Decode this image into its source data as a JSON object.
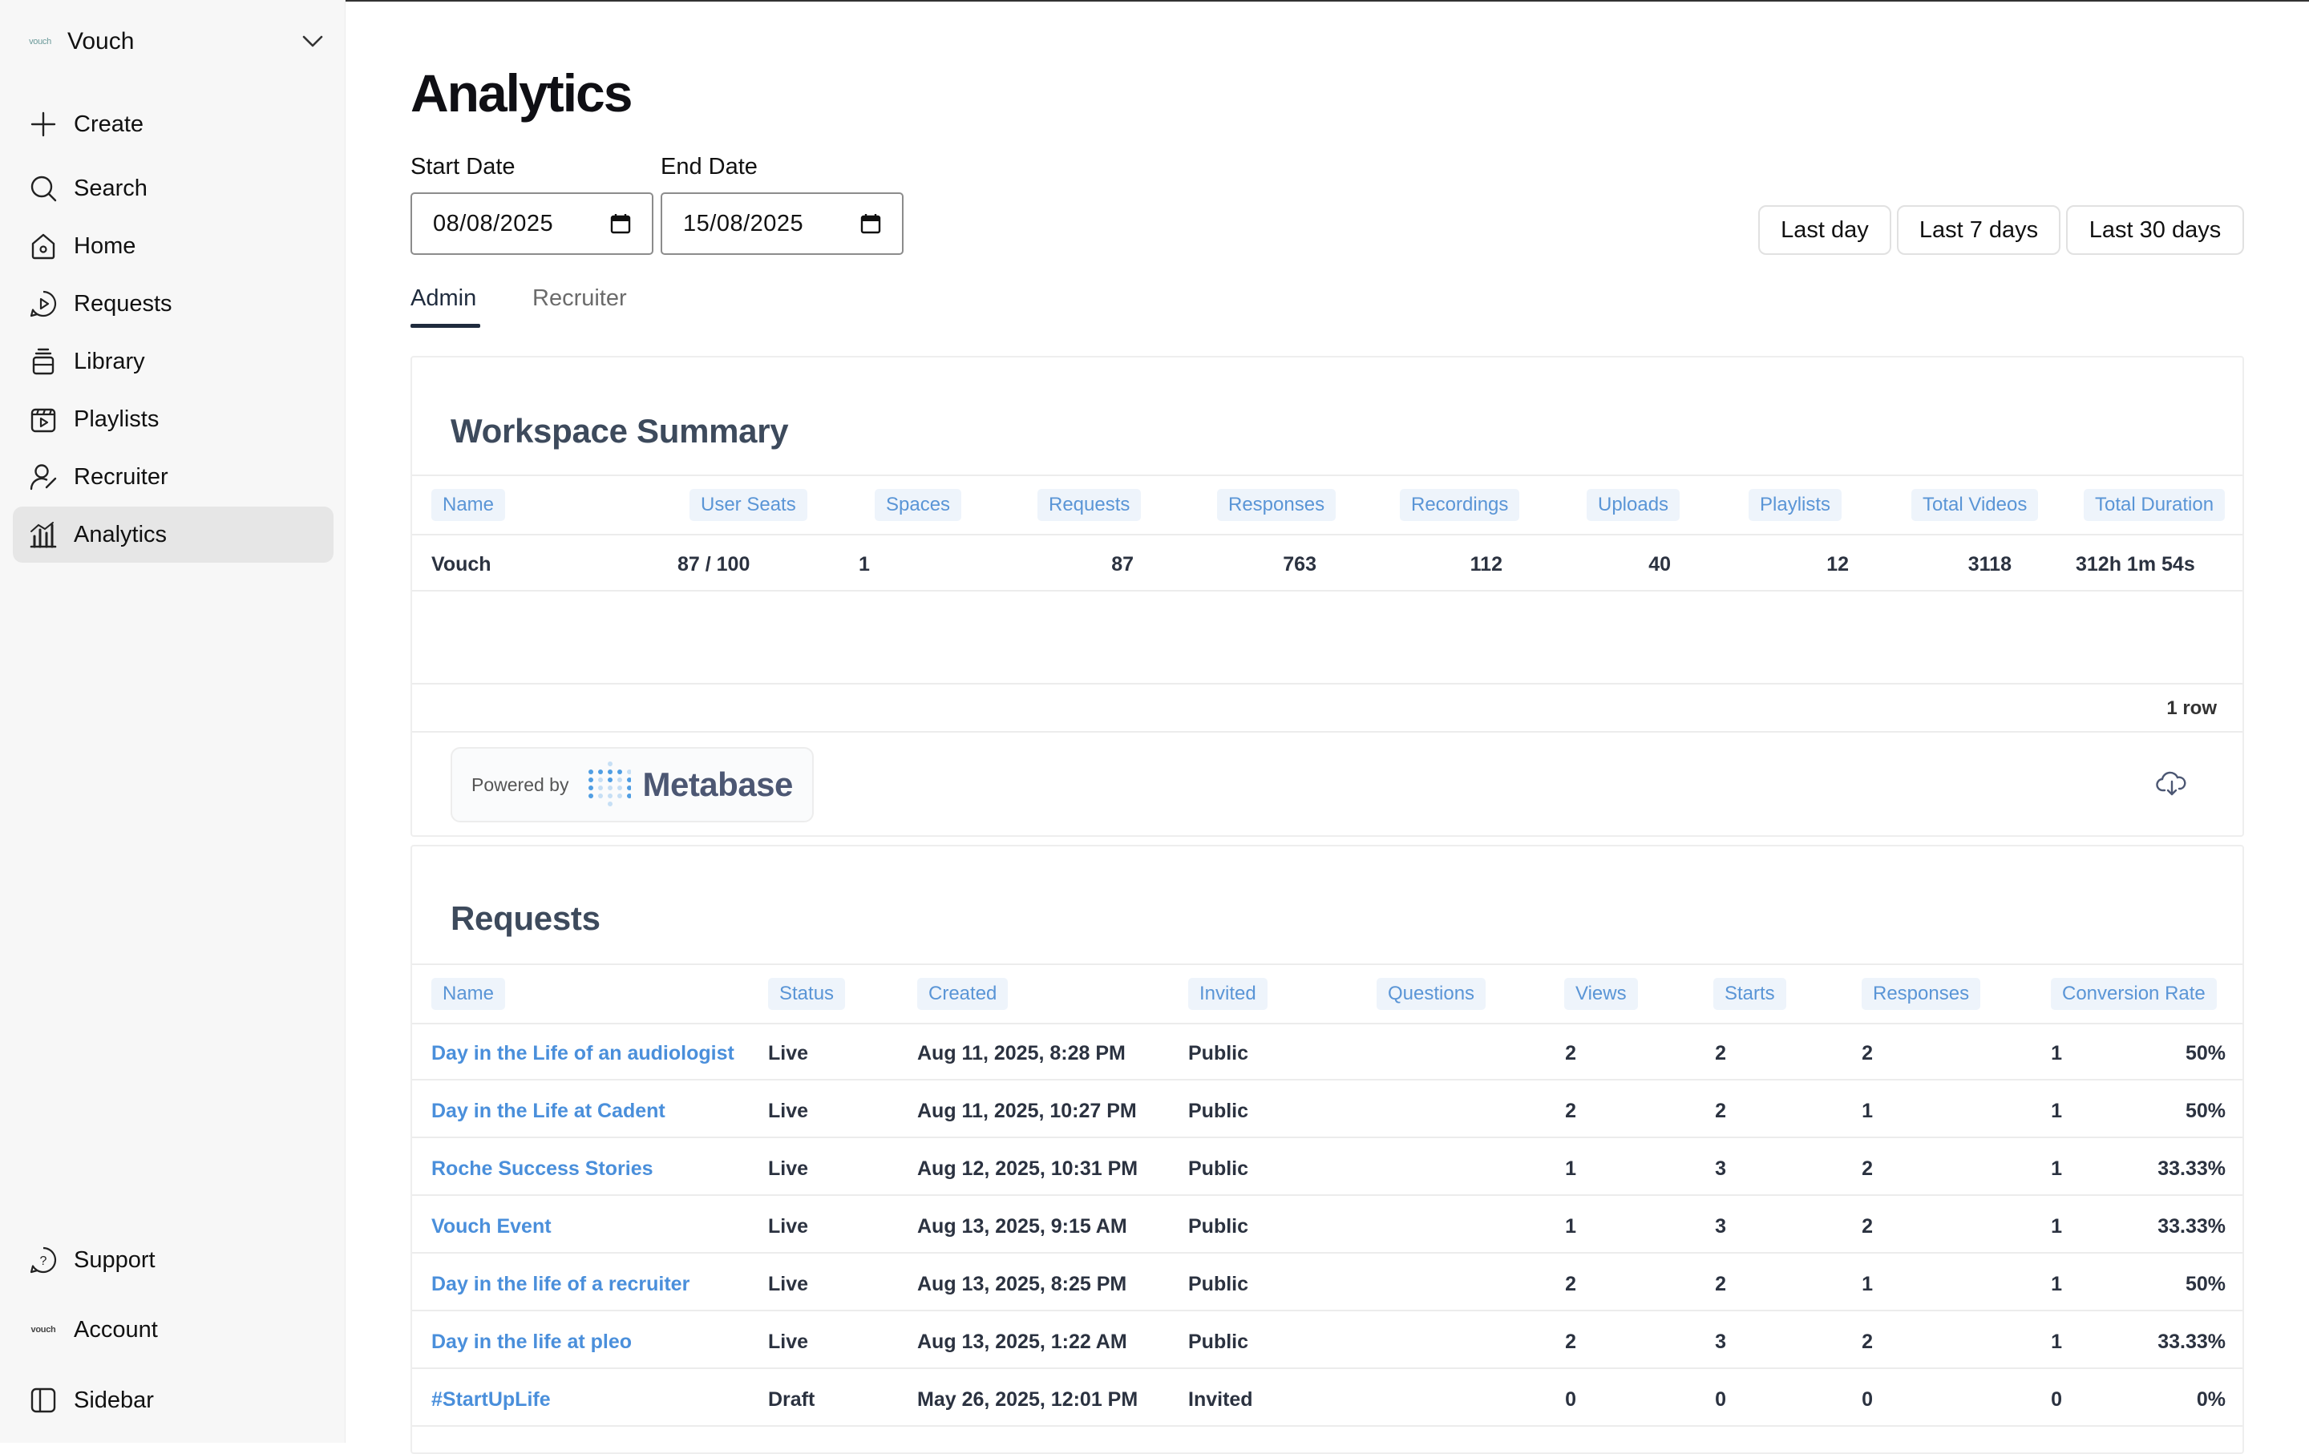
{
  "workspace": {
    "name": "Vouch",
    "logo_text": "vouch"
  },
  "sidebar": {
    "items": [
      {
        "label": "Create",
        "icon": "plus-icon"
      },
      {
        "label": "Search",
        "icon": "search-icon"
      },
      {
        "label": "Home",
        "icon": "home-icon"
      },
      {
        "label": "Requests",
        "icon": "requests-icon"
      },
      {
        "label": "Library",
        "icon": "library-icon"
      },
      {
        "label": "Playlists",
        "icon": "playlists-icon"
      },
      {
        "label": "Recruiter",
        "icon": "recruiter-icon"
      },
      {
        "label": "Analytics",
        "icon": "analytics-icon",
        "active": true
      }
    ],
    "bottom": [
      {
        "label": "Support",
        "icon": "help-icon"
      },
      {
        "label": "Account",
        "icon": "account-logo"
      },
      {
        "label": "Sidebar",
        "icon": "sidebar-toggle-icon"
      }
    ],
    "account_logo_text": "vouch"
  },
  "page": {
    "title": "Analytics"
  },
  "dates": {
    "start_label": "Start Date",
    "start_value": "08/08/2025",
    "end_label": "End Date",
    "end_value": "15/08/2025"
  },
  "ranges": [
    "Last day",
    "Last 7 days",
    "Last 30 days"
  ],
  "tabs": [
    {
      "label": "Admin",
      "active": true
    },
    {
      "label": "Recruiter",
      "active": false
    }
  ],
  "summary": {
    "title": "Workspace Summary",
    "columns": [
      "Name",
      "User Seats",
      "Spaces",
      "Requests",
      "Responses",
      "Recordings",
      "Uploads",
      "Playlists",
      "Total Videos",
      "Total Duration"
    ],
    "row": [
      "Vouch",
      "87 / 100",
      "1",
      "87",
      "763",
      "112",
      "40",
      "12",
      "3118",
      "312h 1m 54s"
    ],
    "row_count": "1 row",
    "powered_by": "Powered by",
    "metabase": "Metabase"
  },
  "requests": {
    "title": "Requests",
    "columns": [
      "Name",
      "Status",
      "Created",
      "Invited",
      "Questions",
      "Views",
      "Starts",
      "Responses",
      "Conversion Rate"
    ],
    "rows": [
      [
        "Day in the Life of an audiologist",
        "Live",
        "Aug 11, 2025, 8:28 PM",
        "Public",
        "2",
        "2",
        "2",
        "1",
        "50%"
      ],
      [
        "Day in the Life at Cadent",
        "Live",
        "Aug 11, 2025, 10:27 PM",
        "Public",
        "2",
        "2",
        "1",
        "1",
        "50%"
      ],
      [
        "Roche Success Stories",
        "Live",
        "Aug 12, 2025, 10:31 PM",
        "Public",
        "1",
        "3",
        "2",
        "1",
        "33.33%"
      ],
      [
        "Vouch Event",
        "Live",
        "Aug 13, 2025, 9:15 AM",
        "Public",
        "1",
        "3",
        "2",
        "1",
        "33.33%"
      ],
      [
        "Day in the life of a recruiter",
        "Live",
        "Aug 13, 2025, 8:25 PM",
        "Public",
        "2",
        "2",
        "1",
        "1",
        "50%"
      ],
      [
        "Day in the life at pleo",
        "Live",
        "Aug 13, 2025, 1:22 AM",
        "Public",
        "2",
        "3",
        "2",
        "1",
        "33.33%"
      ],
      [
        "#StartUpLife",
        "Draft",
        "May 26, 2025, 12:01 PM",
        "Invited",
        "0",
        "0",
        "0",
        "0",
        "0%"
      ]
    ]
  }
}
